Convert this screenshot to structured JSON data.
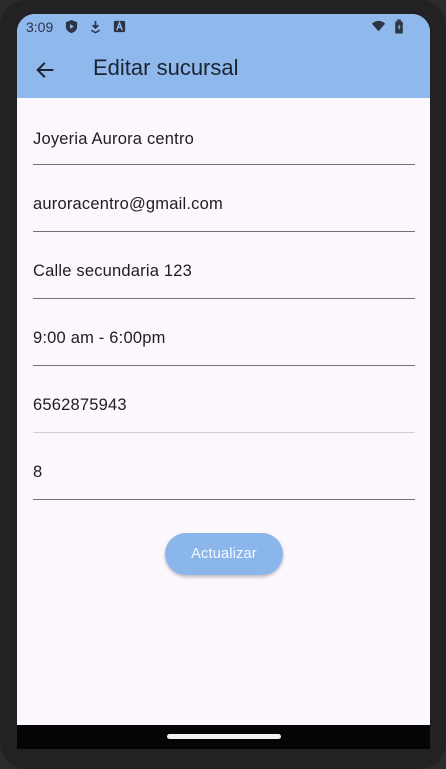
{
  "status_bar": {
    "time": "3:09",
    "icons_left": [
      "play-protect-icon",
      "download-icon",
      "a-icon"
    ],
    "icons_right": [
      "wifi-icon",
      "battery-icon"
    ]
  },
  "app_bar": {
    "title": "Editar sucursal",
    "back_icon": "arrow-back-icon",
    "color": "#8fb8ec"
  },
  "form": {
    "fields": [
      {
        "name": "nombre",
        "value": "Joyeria Aurora centro"
      },
      {
        "name": "email",
        "value": "auroracentro@gmail.com"
      },
      {
        "name": "direccion",
        "value": "Calle secundaria 123"
      },
      {
        "name": "horario",
        "value": "9:00 am - 6:00pm"
      },
      {
        "name": "telefono",
        "value": "6562875943"
      },
      {
        "name": "numero",
        "value": "8"
      }
    ]
  },
  "actions": {
    "update_label": "Actualizar"
  }
}
